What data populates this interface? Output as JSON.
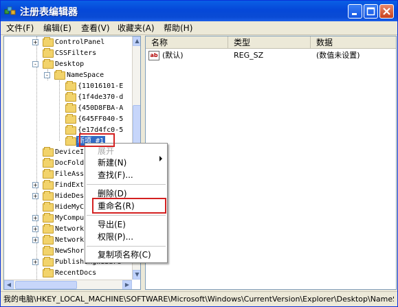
{
  "window": {
    "title": "注册表编辑器"
  },
  "menubar": [
    "文件(F)",
    "编辑(E)",
    "查看(V)",
    "收藏夹(A)",
    "帮助(H)"
  ],
  "tree": [
    {
      "label": "ControlPanel",
      "level": 0,
      "expander": "+"
    },
    {
      "label": "CSSFilters",
      "level": 0,
      "expander": ""
    },
    {
      "label": "Desktop",
      "level": 0,
      "expander": "-"
    },
    {
      "label": "NameSpace",
      "level": 1,
      "expander": "-"
    },
    {
      "label": "{11016101-E",
      "level": 2,
      "expander": ""
    },
    {
      "label": "{1f4de370-d",
      "level": 2,
      "expander": ""
    },
    {
      "label": "{450D8FBA-A",
      "level": 2,
      "expander": ""
    },
    {
      "label": "{645FF040-5",
      "level": 2,
      "expander": ""
    },
    {
      "label": "{e17d4fc0-5",
      "level": 2,
      "expander": ""
    },
    {
      "label": "新项 #1",
      "level": 2,
      "expander": "",
      "selected": true
    },
    {
      "label": "DeviceI",
      "level": 0,
      "expander": ""
    },
    {
      "label": "DocFold",
      "level": 0,
      "expander": ""
    },
    {
      "label": "FileAss",
      "level": 0,
      "expander": ""
    },
    {
      "label": "FindExt",
      "level": 0,
      "expander": "+"
    },
    {
      "label": "HideDes",
      "level": 0,
      "expander": "+"
    },
    {
      "label": "HideMyC",
      "level": 0,
      "expander": ""
    },
    {
      "label": "MyCompu",
      "level": 0,
      "expander": "+"
    },
    {
      "label": "Network",
      "level": 0,
      "expander": "+"
    },
    {
      "label": "Network",
      "level": 0,
      "expander": "+"
    },
    {
      "label": "NewShor",
      "level": 0,
      "expander": ""
    },
    {
      "label": "PublishingWizard",
      "level": 0,
      "expander": "+"
    },
    {
      "label": "RecentDocs",
      "level": 0,
      "expander": ""
    }
  ],
  "columns": {
    "name": "名称",
    "type": "类型",
    "data": "数据"
  },
  "values": [
    {
      "icon": "ab",
      "name": "(默认)",
      "type": "REG_SZ",
      "data": "(数值未设置)"
    }
  ],
  "context_menu": {
    "expand": "展开",
    "new": "新建(N)",
    "find": "查找(F)...",
    "delete": "删除(D)",
    "rename": "重命名(R)",
    "export": "导出(E)",
    "permissions": "权限(P)...",
    "copy_key_name": "复制项名称(C)"
  },
  "status": {
    "path": "我的电脑\\HKEY_LOCAL_MACHINE\\SOFTWARE\\Microsoft\\Windows\\CurrentVersion\\Explorer\\Desktop\\NameS"
  },
  "colors": {
    "title_bar": "#0a5fe6",
    "selection": "#316ac5",
    "highlight_box": "#d42020"
  }
}
